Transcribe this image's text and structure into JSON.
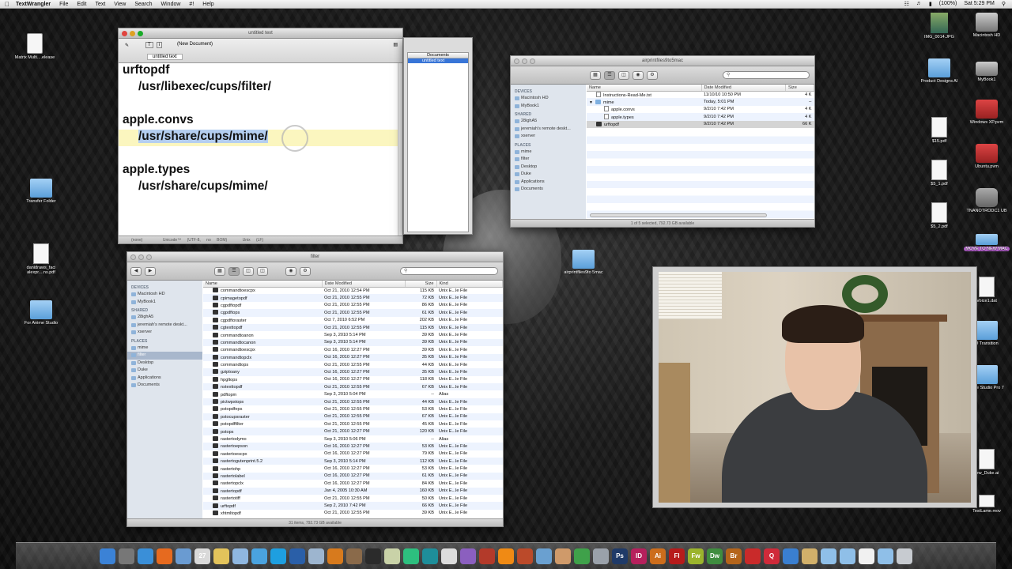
{
  "menubar": {
    "app": "TextWrangler",
    "items": [
      "File",
      "Edit",
      "Text",
      "View",
      "Search",
      "Window",
      "#!",
      "Help"
    ],
    "battery": "(100%)",
    "clock": "Sat 5:29 PM"
  },
  "textwrangler": {
    "title": "untitled text",
    "doc_label": "(New Document)",
    "tab_label": "untitled text",
    "drawer_header": "Documents",
    "drawer_item": "untitled text",
    "lines": [
      "urftopdf",
      "/usr/libexec/cups/filter/",
      "apple.convs",
      "/usr/share/cups/mime/",
      "apple.types",
      "/usr/share/cups/mime/"
    ],
    "status": [
      "(none)",
      "Unicode™ (UTF-8, no BOM)",
      "Unix (LF)"
    ]
  },
  "finder_top": {
    "title": "airprintfiles9to5mac",
    "columns": [
      "Name",
      "Date Modified",
      "Size"
    ],
    "rows": [
      {
        "name": "Instructions-Read-Me.txt",
        "date": "11/10/10 10:50 PM",
        "size": "4 K"
      },
      {
        "name": "mime",
        "date": "Today, 5:01 PM",
        "size": "--"
      },
      {
        "name": "apple.convs",
        "date": "9/2/10 7:42 PM",
        "size": "4 K"
      },
      {
        "name": "apple.types",
        "date": "9/2/10 7:42 PM",
        "size": "4 K"
      },
      {
        "name": "urftopdf",
        "date": "9/2/10 7:42 PM",
        "size": "66 K"
      }
    ],
    "status": "1 of 5 selected, 792.73 GB available"
  },
  "sidebar": {
    "devices_header": "DEVICES",
    "devices": [
      "Macintosh HD",
      "MyBook1"
    ],
    "shared_header": "SHARED",
    "shared": [
      "28ighA5",
      "jeremiah's remote deskt...",
      "xserver"
    ],
    "places_header": "PLACES",
    "places": [
      "mime",
      "filter",
      "Desktop",
      "Duke",
      "Applications",
      "Documents"
    ]
  },
  "finder_bottom": {
    "title": "filter",
    "columns": [
      "Name",
      "Date Modified",
      "Size",
      "Kind"
    ],
    "rows": [
      [
        "commandtoescpx",
        "Oct 21, 2010 12:54 PM",
        "115 KB",
        "Unix E...le File"
      ],
      [
        "cpimagetopdf",
        "Oct 21, 2010 12:55 PM",
        "72 KB",
        "Unix E...le File"
      ],
      [
        "cgpdftopdf",
        "Oct 21, 2010 12:55 PM",
        "86 KB",
        "Unix E...le File"
      ],
      [
        "cgpdftops",
        "Oct 21, 2010 12:55 PM",
        "61 KB",
        "Unix E...le File"
      ],
      [
        "cgpdftoraster",
        "Oct 7, 2010 6:52 PM",
        "202 KB",
        "Unix E...le File"
      ],
      [
        "cgtexttopdf",
        "Oct 21, 2010 12:55 PM",
        "115 KB",
        "Unix E...le File"
      ],
      [
        "commandtoanon",
        "Sep 3, 2010 5:14 PM",
        "39 KB",
        "Unix E...le File"
      ],
      [
        "commandtocanon",
        "Sep 3, 2010 5:14 PM",
        "39 KB",
        "Unix E...le File"
      ],
      [
        "commandtoescpx",
        "Oct 16, 2010 12:27 PM",
        "39 KB",
        "Unix E...le File"
      ],
      [
        "commandtopclx",
        "Oct 16, 2010 12:27 PM",
        "35 KB",
        "Unix E...le File"
      ],
      [
        "commandtops",
        "Oct 21, 2010 12:55 PM",
        "44 KB",
        "Unix E...le File"
      ],
      [
        "gziptoany",
        "Oct 16, 2010 12:27 PM",
        "35 KB",
        "Unix E...le File"
      ],
      [
        "hpgltops",
        "Oct 16, 2010 12:27 PM",
        "118 KB",
        "Unix E...le File"
      ],
      [
        "nstexttopdf",
        "Oct 21, 2010 12:55 PM",
        "67 KB",
        "Unix E...le File"
      ],
      [
        "pdftopm",
        "Sep 3, 2010 5:04 PM",
        "--",
        "Alias"
      ],
      [
        "pictwpstops",
        "Oct 21, 2010 12:55 PM",
        "44 KB",
        "Unix E...le File"
      ],
      [
        "pstopdfeps",
        "Oct 21, 2010 12:55 PM",
        "53 KB",
        "Unix E...le File"
      ],
      [
        "pstocupsraster",
        "Oct 21, 2010 12:55 PM",
        "67 KB",
        "Unix E...le File"
      ],
      [
        "pstopdffilter",
        "Oct 21, 2010 12:55 PM",
        "45 KB",
        "Unix E...le File"
      ],
      [
        "pstops",
        "Oct 21, 2010 12:27 PM",
        "120 KB",
        "Unix E...le File"
      ],
      [
        "rastertodymo",
        "Sep 3, 2010 5:06 PM",
        "--",
        "Alias"
      ],
      [
        "rastertoepson",
        "Oct 16, 2010 12:27 PM",
        "53 KB",
        "Unix E...le File"
      ],
      [
        "rastertoescpx",
        "Oct 16, 2010 12:27 PM",
        "79 KB",
        "Unix E...le File"
      ],
      [
        "rastertogutenprint.5.2",
        "Sep 3, 2010 5:14 PM",
        "112 KB",
        "Unix E...le File"
      ],
      [
        "rastertohp",
        "Oct 16, 2010 12:27 PM",
        "53 KB",
        "Unix E...le File"
      ],
      [
        "rastertolabel",
        "Oct 16, 2010 12:27 PM",
        "61 KB",
        "Unix E...le File"
      ],
      [
        "rastertopclx",
        "Oct 16, 2010 12:27 PM",
        "84 KB",
        "Unix E...le File"
      ],
      [
        "rastertopdf",
        "Jan 4, 2005 10:30 AM",
        "160 KB",
        "Unix E...le File"
      ],
      [
        "rastertotiff",
        "Oct 21, 2010 12:55 PM",
        "50 KB",
        "Unix E...le File"
      ],
      [
        "urftopdf",
        "Sep 2, 2010 7:42 PM",
        "66 KB",
        "Unix E...le File"
      ],
      [
        "xhtmltopdf",
        "Oct 21, 2010 12:55 PM",
        "39 KB",
        "Unix E...le File"
      ]
    ],
    "status": "31 items, 792.73 GB available"
  },
  "desktop_left": [
    {
      "label": "Matrix Multi....elease",
      "icon": "http-file-icon"
    },
    {
      "label": "Transfer Folder",
      "icon": "folder-icon"
    },
    {
      "label": "danidraws_faci alexpr....ns.pdf",
      "icon": "document-icon"
    },
    {
      "label": "For Anime Studio",
      "icon": "folder-icon"
    }
  ],
  "desktop_center": {
    "label": "airprintfiles9to 5mac",
    "icon": "folder-icon"
  },
  "desktop_right": [
    {
      "label": "IMG_0014.JPG",
      "icon": "image-icon"
    },
    {
      "label": "Macintosh HD",
      "icon": "drive-icon"
    },
    {
      "label": "Product Designs AI",
      "icon": "folder-icon"
    },
    {
      "label": "MyBook1",
      "icon": "drive-icon"
    },
    {
      "label": "Windows XP.pvm",
      "icon": "parallels-icon"
    },
    {
      "label": "$15.pdf",
      "icon": "pdf-icon"
    },
    {
      "label": "Ubuntu.pvm",
      "icon": "parallels-icon"
    },
    {
      "label": "$5_1.pdf",
      "icon": "pdf-icon"
    },
    {
      "label": "TNANOTRODC1 UB",
      "icon": "robot-icon"
    },
    {
      "label": "$5_2.pdf",
      "icon": "pdf-icon"
    },
    {
      "label": "MOVE TO NEW MAC",
      "icon": "folder-icon"
    },
    {
      "label": "Voice1.dat",
      "icon": "document-icon"
    },
    {
      "label": "D Transition",
      "icon": "folder-icon"
    },
    {
      "label": "nime Studio Pro 7",
      "icon": "folder-icon"
    },
    {
      "label": "rew_Duke.ai",
      "icon": "ai-file-icon"
    },
    {
      "label": "TestLame.mov",
      "icon": "movie-icon"
    }
  ],
  "dock_apps": [
    {
      "name": "finder",
      "color": "#3b82d6",
      "glyph": ""
    },
    {
      "name": "system-prefs",
      "color": "#777777",
      "glyph": ""
    },
    {
      "name": "safari",
      "color": "#3a8fd8",
      "glyph": ""
    },
    {
      "name": "firefox",
      "color": "#e66a1f",
      "glyph": ""
    },
    {
      "name": "preview",
      "color": "#6a9bd1",
      "glyph": ""
    },
    {
      "name": "ical",
      "color": "#d9d9d9",
      "glyph": "27"
    },
    {
      "name": "notes",
      "color": "#e3c35b",
      "glyph": ""
    },
    {
      "name": "itunes",
      "color": "#8fb7e0",
      "glyph": ""
    },
    {
      "name": "ichat",
      "color": "#4aa3df",
      "glyph": ""
    },
    {
      "name": "skype",
      "color": "#1e9fe0",
      "glyph": ""
    },
    {
      "name": "photoshop-elements",
      "color": "#2a5fa8",
      "glyph": ""
    },
    {
      "name": "mail",
      "color": "#9db5cf",
      "glyph": ""
    },
    {
      "name": "blender",
      "color": "#d77a1d",
      "glyph": ""
    },
    {
      "name": "xcode",
      "color": "#8a6a4a",
      "glyph": ""
    },
    {
      "name": "terminal",
      "color": "#2b2b2b",
      "glyph": ""
    },
    {
      "name": "textwrangler",
      "color": "#c9d2a8",
      "glyph": ""
    },
    {
      "name": "aquamacs",
      "color": "#2dbf7f",
      "glyph": ""
    },
    {
      "name": "arduino",
      "color": "#1e8e9a",
      "glyph": ""
    },
    {
      "name": "utility",
      "color": "#dcdcdc",
      "glyph": ""
    },
    {
      "name": "phpstorm",
      "color": "#8b5fbf",
      "glyph": ""
    },
    {
      "name": "filezilla",
      "color": "#b33a2a",
      "glyph": ""
    },
    {
      "name": "vlc",
      "color": "#f08a14",
      "glyph": ""
    },
    {
      "name": "lamp",
      "color": "#bb4a2a",
      "glyph": ""
    },
    {
      "name": "pencil",
      "color": "#6aa0d0",
      "glyph": ""
    },
    {
      "name": "apple-pie",
      "color": "#cf9a6a",
      "glyph": ""
    },
    {
      "name": "dreamweaver-green",
      "color": "#3fa14a",
      "glyph": ""
    },
    {
      "name": "bridge",
      "color": "#9aa1aa",
      "glyph": ""
    },
    {
      "name": "ps",
      "color": "#1f3a68",
      "glyph": "Ps"
    },
    {
      "name": "id",
      "color": "#b6205c",
      "glyph": "ID"
    },
    {
      "name": "ai",
      "color": "#cc6d1c",
      "glyph": "Ai"
    },
    {
      "name": "fl",
      "color": "#b71b1b",
      "glyph": "Fl"
    },
    {
      "name": "fw",
      "color": "#9bb42c",
      "glyph": "Fw"
    },
    {
      "name": "dw",
      "color": "#3f8d3f",
      "glyph": "Dw"
    },
    {
      "name": "br",
      "color": "#b5651b",
      "glyph": "Br"
    },
    {
      "name": "acrobat",
      "color": "#c92a2a",
      "glyph": ""
    },
    {
      "name": "q",
      "color": "#d02a3a",
      "glyph": "Q"
    },
    {
      "name": "app-store",
      "color": "#3a7fd0",
      "glyph": ""
    },
    {
      "name": "script",
      "color": "#d2b06a",
      "glyph": ""
    },
    {
      "name": "folder-1",
      "color": "#8fbfe8",
      "glyph": ""
    },
    {
      "name": "folder-2",
      "color": "#8fbfe8",
      "glyph": ""
    },
    {
      "name": "document",
      "color": "#f1f1f1",
      "glyph": ""
    },
    {
      "name": "folder-3",
      "color": "#8fbfe8",
      "glyph": ""
    },
    {
      "name": "trash",
      "color": "#c7cbd0",
      "glyph": ""
    }
  ]
}
